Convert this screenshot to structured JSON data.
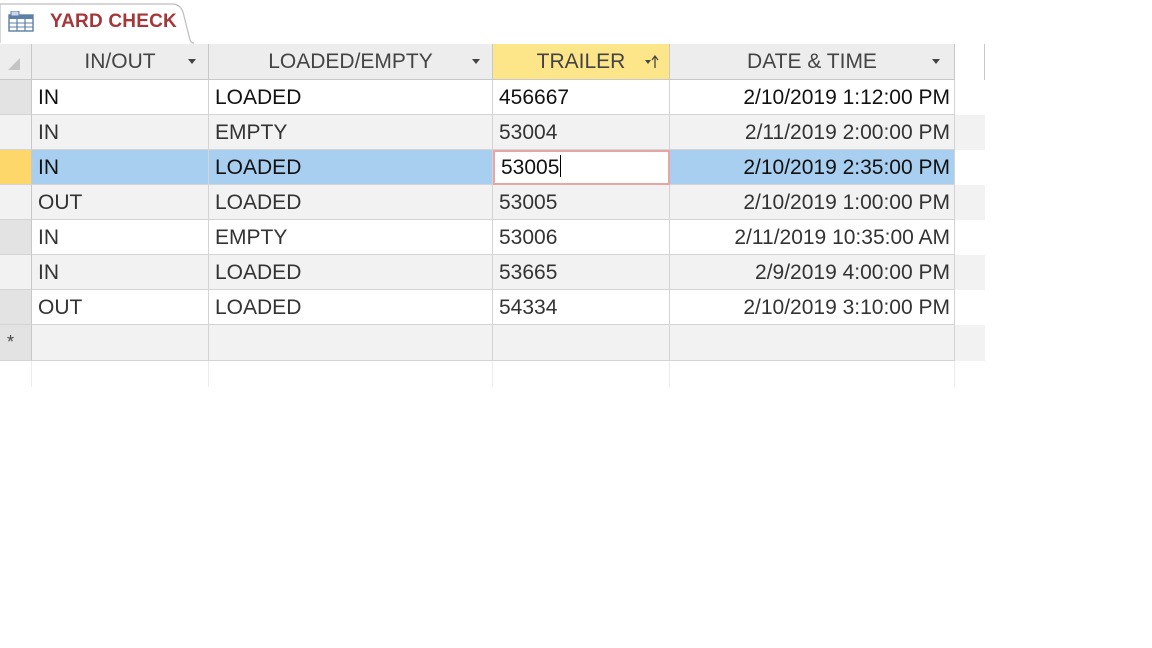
{
  "tab": {
    "title": "YARD CHECK",
    "icon": "table-icon"
  },
  "columns": [
    {
      "label": "IN/OUT",
      "has_dropdown": true
    },
    {
      "label": "LOADED/EMPTY",
      "has_dropdown": true
    },
    {
      "label": "TRAILER",
      "has_dropdown": true,
      "selected": true,
      "sorted": true
    },
    {
      "label": "DATE & TIME",
      "has_dropdown": true
    }
  ],
  "rows": [
    {
      "in_out": "IN",
      "loaded_empty": "LOADED",
      "trailer": "456667",
      "date_time": "2/10/2019 1:12:00 PM"
    },
    {
      "in_out": "IN",
      "loaded_empty": "EMPTY",
      "trailer": "53004",
      "date_time": "2/11/2019 2:00:00 PM"
    },
    {
      "in_out": "IN",
      "loaded_empty": "LOADED",
      "trailer": "53005",
      "date_time": "2/10/2019 2:35:00 PM",
      "current": true
    },
    {
      "in_out": "OUT",
      "loaded_empty": "LOADED",
      "trailer": "53005",
      "date_time": "2/10/2019 1:00:00 PM"
    },
    {
      "in_out": "IN",
      "loaded_empty": "EMPTY",
      "trailer": "53006",
      "date_time": "2/11/2019 10:35:00 AM"
    },
    {
      "in_out": "IN",
      "loaded_empty": "LOADED",
      "trailer": "53665",
      "date_time": "2/9/2019 4:00:00 PM"
    },
    {
      "in_out": "OUT",
      "loaded_empty": "LOADED",
      "trailer": "54334",
      "date_time": "2/10/2019 3:10:00 PM"
    }
  ],
  "new_record_marker": "*",
  "colors": {
    "tab_title": "#a4373a",
    "header_bg": "#ededed",
    "selected_header_bg": "#fde589",
    "current_row_bg": "#a9cff0",
    "current_selector_bg": "#fdd76a",
    "alt_row_bg": "#f2f2f2",
    "edit_cell_border": "#e7a6a6"
  }
}
